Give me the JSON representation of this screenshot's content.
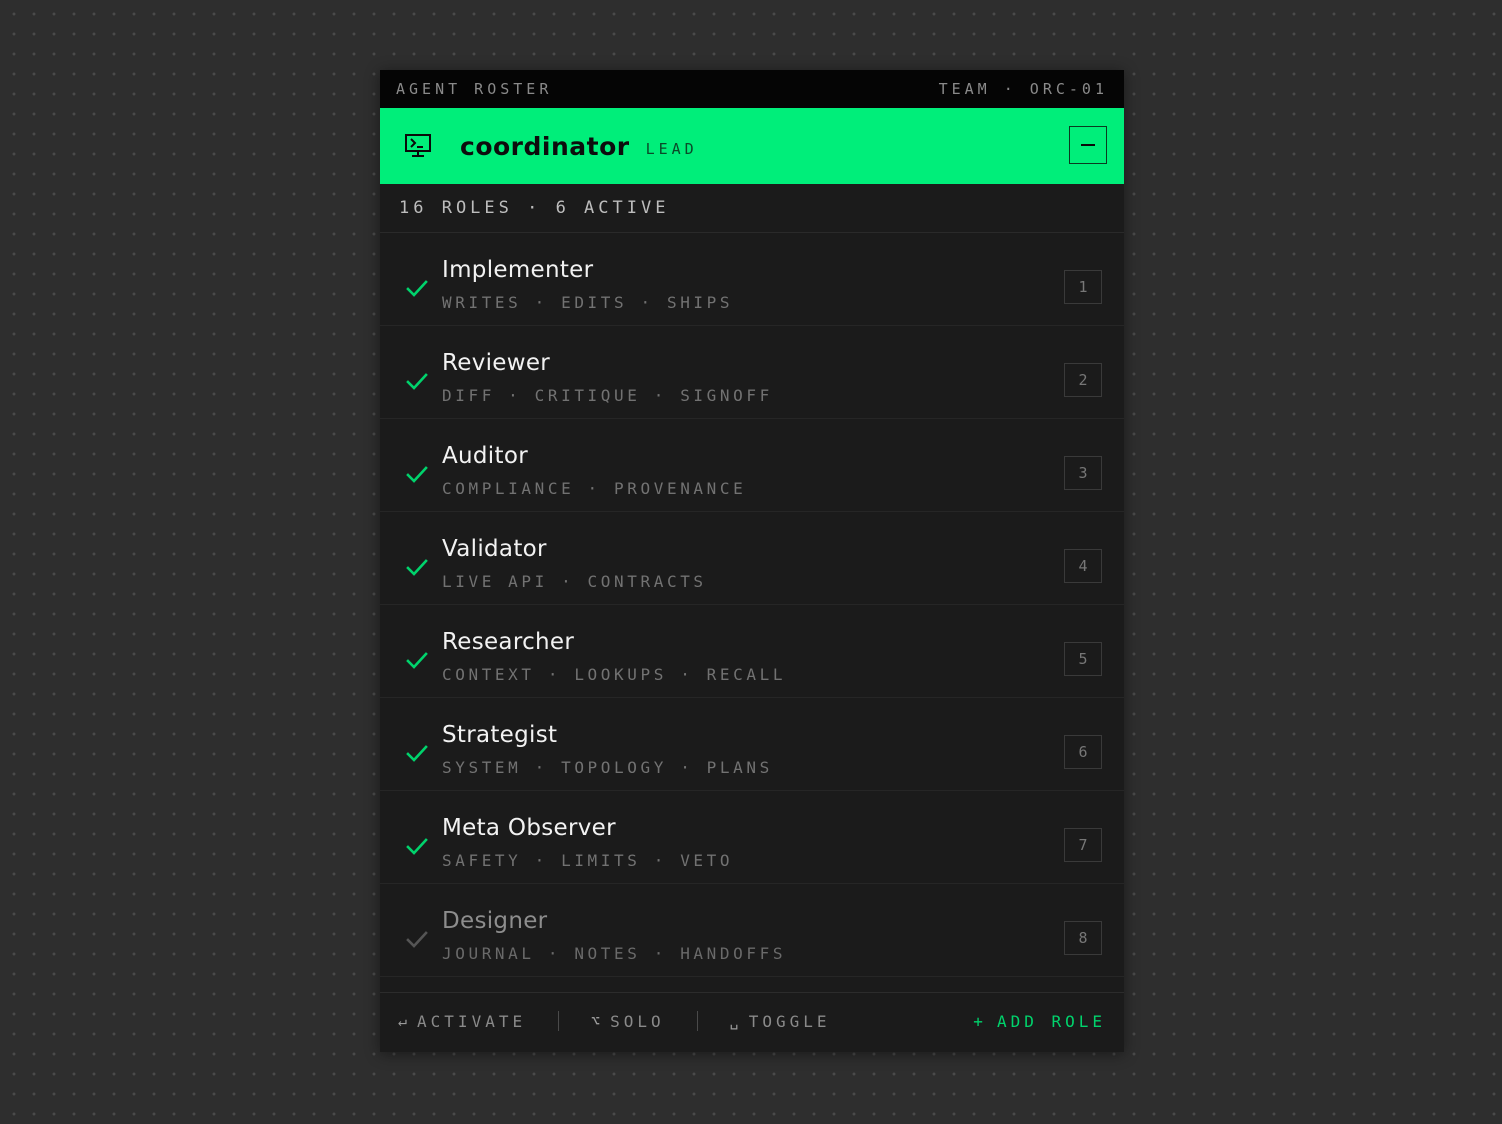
{
  "topbar": {
    "title": "AGENT ROSTER",
    "team": "TEAM · ORC-01"
  },
  "header": {
    "icon": "terminal-icon",
    "title": "coordinator",
    "role_tag": "LEAD",
    "collapse_icon": "minus-icon"
  },
  "summary": {
    "text": "16 ROLES · 6 ACTIVE"
  },
  "roles": [
    {
      "name": "Implementer",
      "tags": "WRITES · EDITS · SHIPS",
      "index": "1",
      "active": true
    },
    {
      "name": "Reviewer",
      "tags": "DIFF · CRITIQUE · SIGNOFF",
      "index": "2",
      "active": true
    },
    {
      "name": "Auditor",
      "tags": "COMPLIANCE · PROVENANCE",
      "index": "3",
      "active": true
    },
    {
      "name": "Validator",
      "tags": "LIVE API · CONTRACTS",
      "index": "4",
      "active": true
    },
    {
      "name": "Researcher",
      "tags": "CONTEXT · LOOKUPS · RECALL",
      "index": "5",
      "active": true
    },
    {
      "name": "Strategist",
      "tags": "SYSTEM · TOPOLOGY · PLANS",
      "index": "6",
      "active": true
    },
    {
      "name": "Meta Observer",
      "tags": "SAFETY · LIMITS · VETO",
      "index": "7",
      "active": true
    },
    {
      "name": "Designer",
      "tags": "JOURNAL · NOTES · HANDOFFS",
      "index": "8",
      "active": false
    }
  ],
  "footer": {
    "activate": {
      "glyph": "↵",
      "label": "ACTIVATE"
    },
    "solo": {
      "glyph": "⌥",
      "label": "SOLO"
    },
    "toggle": {
      "glyph": "␣",
      "label": "TOGGLE"
    },
    "add": {
      "glyph": "+",
      "label": "ADD ROLE"
    }
  },
  "colors": {
    "accent": "#00ee7a",
    "check_active": "#00d36c",
    "check_inactive": "#555555",
    "panel_bg": "#1b1b1b",
    "page_bg": "#2e2e2e"
  }
}
